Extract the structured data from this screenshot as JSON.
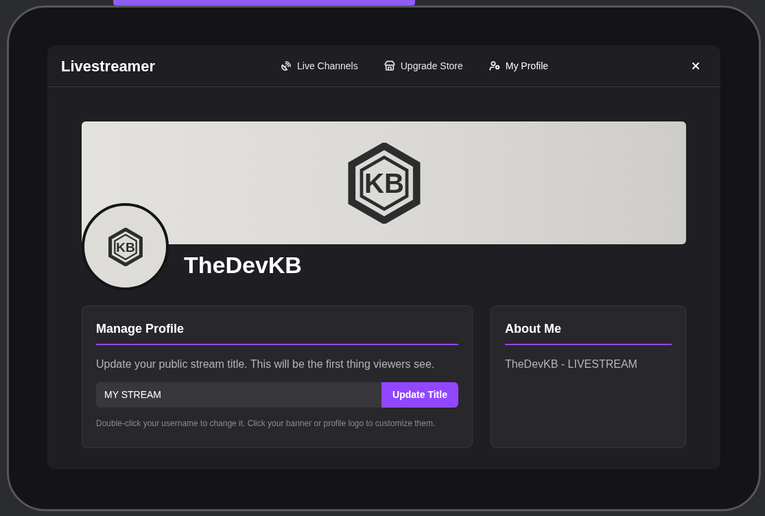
{
  "app": {
    "title": "Livestreamer"
  },
  "nav": [
    {
      "label": "Live Channels",
      "kind": "channels",
      "selected": false
    },
    {
      "label": "Upgrade Store",
      "kind": "store",
      "selected": false
    },
    {
      "label": "My Profile",
      "kind": "profile",
      "selected": true
    }
  ],
  "profile": {
    "banner_logo_text": "KB",
    "avatar_logo_text": "KB",
    "username": "TheDevKB"
  },
  "manage_profile": {
    "title": "Manage Profile",
    "description": "Update your public stream title. This will be the first thing viewers see.",
    "title_field": {
      "value": "MY STREAM"
    },
    "button": "Update Title",
    "hint": "Double-click your username to change it. Click your banner or profile logo to customize them."
  },
  "about_me": {
    "title": "About Me",
    "text": "TheDevKB - LIVESTREAM"
  }
}
